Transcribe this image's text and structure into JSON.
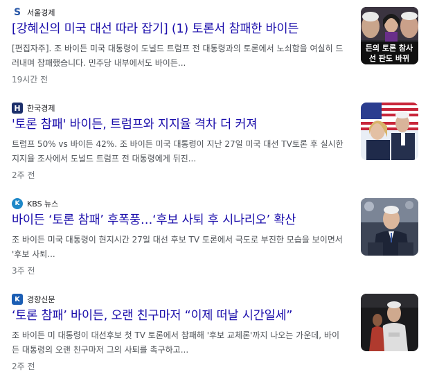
{
  "results": [
    {
      "source": "서울경제",
      "logo_char": "S",
      "logo_color": "#2a58a8",
      "title": "[강혜신의 미국 대선 따라 잡기] (1) 토론서 참패한 바이든",
      "snippet": "[편집자주]. 조 바이든 미국 대통령이 도널드 트럼프 전 대통령과의 토론에서 노쇠함을 여실히 드러내며 참패했습니다. 민주당 내부에서도 바이든...",
      "age": "19시간 전",
      "thumb_caption_line1": "든의 토론 참사",
      "thumb_caption_line2": "선 판도 바뀌"
    },
    {
      "source": "한국경제",
      "logo_char": "H",
      "logo_color": "#1c2f6b",
      "title": "'토론 참패' 바이든, 트럼프와 지지율 격차 더 커져",
      "snippet": "트럼프 50% vs 바이든 42%. 조 바이든 미국 대통령이 지난 27일 미국 대선 TV토론 후 실시한 지지율 조사에서 도널드 트럼프 전 대통령에게 뒤진...",
      "age": "2주 전"
    },
    {
      "source": "KBS 뉴스",
      "logo_char": "K",
      "logo_color": "#1e88c8",
      "title": "바이든 ‘토론 참패’ 후폭풍…‘후보 사퇴 후 시나리오’ 확산",
      "snippet": "조 바이든 미국 대통령이 현지시간 27일 대선 후보 TV 토론에서 극도로 부진한 모습을 보이면서 '후보 사퇴...",
      "age": "3주 전"
    },
    {
      "source": "경향신문",
      "logo_char": "K",
      "logo_color": "#1b5eb4",
      "title": "‘토론 참패’ 바이든, 오랜 친구마저 “이제 떠날 시간일세”",
      "snippet": "조 바이든 미 대통령이 대선후보 첫 TV 토론에서 참패해 '후보 교체론'까지 나오는 가운데, 바이든 대통령의 오랜 친구마저 그의 사퇴를 촉구하고...",
      "age": "2주 전"
    }
  ]
}
